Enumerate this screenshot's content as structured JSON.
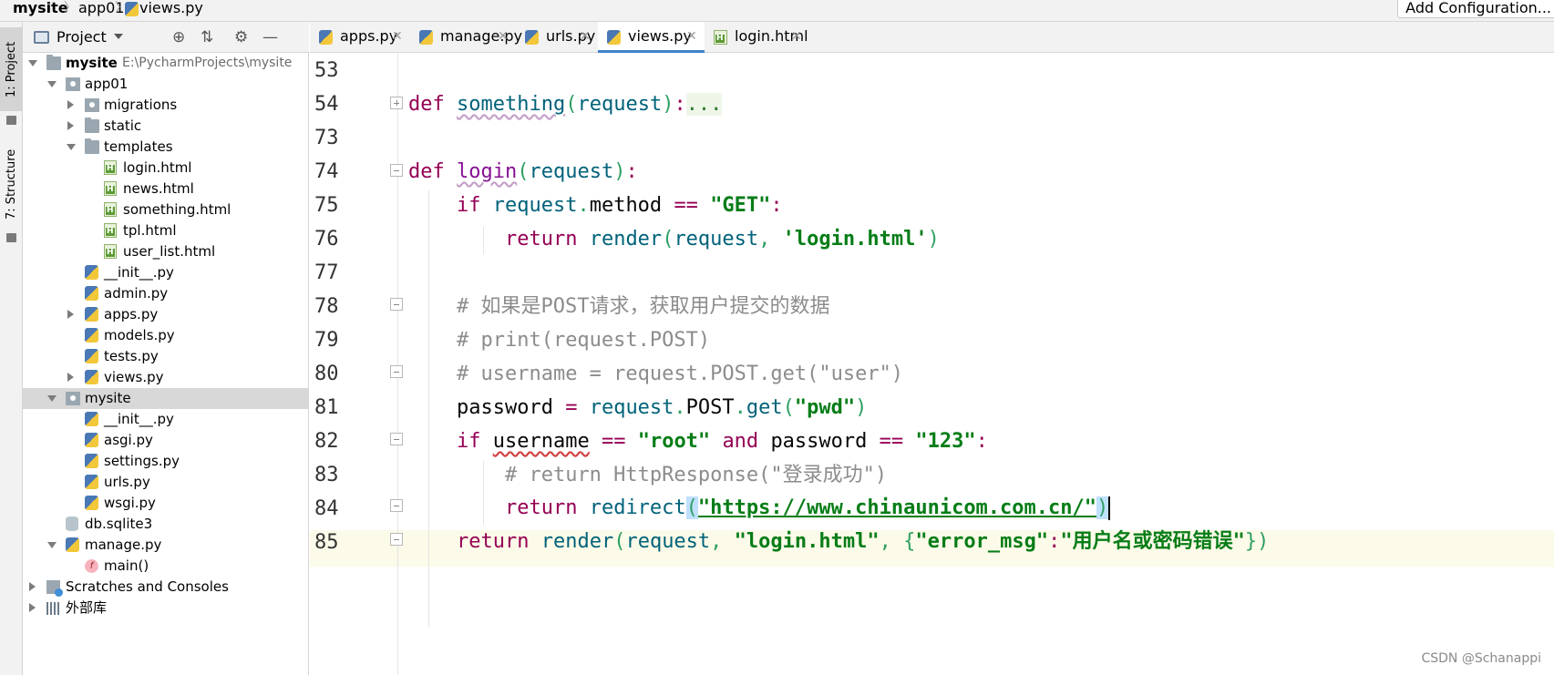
{
  "breadcrumb": [
    "mysite",
    "app01",
    "views.py"
  ],
  "toolbar": {
    "add_config": "Add Configuration..."
  },
  "stripe": {
    "project": "1: Project",
    "structure": "7: Structure"
  },
  "project_panel": {
    "title": "Project",
    "tree": [
      {
        "label": "mysite",
        "path": "E:\\PycharmProjects\\mysite",
        "icon": "folder-icon",
        "arrow": "open",
        "depth": 0,
        "bold": true
      },
      {
        "label": "app01",
        "icon": "package-icon",
        "arrow": "open",
        "depth": 1
      },
      {
        "label": "migrations",
        "icon": "package-icon",
        "arrow": "closed",
        "depth": 2
      },
      {
        "label": "static",
        "icon": "folder-icon",
        "arrow": "closed",
        "depth": 2
      },
      {
        "label": "templates",
        "icon": "folder-icon",
        "arrow": "open",
        "depth": 2
      },
      {
        "label": "login.html",
        "icon": "html-file-icon",
        "depth": 3
      },
      {
        "label": "news.html",
        "icon": "html-file-icon",
        "depth": 3
      },
      {
        "label": "something.html",
        "icon": "html-file-icon",
        "depth": 3
      },
      {
        "label": "tpl.html",
        "icon": "html-file-icon",
        "depth": 3
      },
      {
        "label": "user_list.html",
        "icon": "html-file-icon",
        "depth": 3
      },
      {
        "label": "__init__.py",
        "icon": "python-file-icon",
        "depth": 2
      },
      {
        "label": "admin.py",
        "icon": "python-file-icon",
        "depth": 2
      },
      {
        "label": "apps.py",
        "icon": "python-file-icon",
        "arrow": "closed",
        "depth": 2
      },
      {
        "label": "models.py",
        "icon": "python-file-icon",
        "depth": 2
      },
      {
        "label": "tests.py",
        "icon": "python-file-icon",
        "depth": 2
      },
      {
        "label": "views.py",
        "icon": "python-file-icon",
        "arrow": "closed",
        "depth": 2
      },
      {
        "label": "mysite",
        "icon": "package-icon",
        "arrow": "open",
        "depth": 1,
        "selected": true
      },
      {
        "label": "__init__.py",
        "icon": "python-file-icon",
        "depth": 2
      },
      {
        "label": "asgi.py",
        "icon": "python-file-icon",
        "depth": 2
      },
      {
        "label": "settings.py",
        "icon": "python-file-icon",
        "depth": 2
      },
      {
        "label": "urls.py",
        "icon": "python-file-icon",
        "depth": 2
      },
      {
        "label": "wsgi.py",
        "icon": "python-file-icon",
        "depth": 2
      },
      {
        "label": "db.sqlite3",
        "icon": "database-icon",
        "depth": 1
      },
      {
        "label": "manage.py",
        "icon": "python-file-icon",
        "arrow": "open",
        "depth": 1
      },
      {
        "label": "main()",
        "icon": "function-icon",
        "depth": 2
      },
      {
        "label": "Scratches and Consoles",
        "icon": "scratches-icon",
        "arrow": "closed",
        "depth": 0
      },
      {
        "label": "外部库",
        "icon": "library-icon",
        "arrow": "closed",
        "depth": 0
      }
    ]
  },
  "tabs": [
    {
      "label": "apps.py",
      "icon": "python-file-icon"
    },
    {
      "label": "manage.py",
      "icon": "python-file-icon"
    },
    {
      "label": "urls.py",
      "icon": "python-file-icon"
    },
    {
      "label": "views.py",
      "icon": "python-file-icon",
      "active": true
    },
    {
      "label": "login.html",
      "icon": "html-file-icon"
    }
  ],
  "editor": {
    "line_numbers": [
      "53",
      "54",
      "73",
      "74",
      "75",
      "76",
      "77",
      "78",
      "79",
      "80",
      "81",
      "82",
      "83",
      "84",
      "85"
    ],
    "code": {
      "l54_def": "def",
      "l54_name": "something",
      "l54_param": "request",
      "l54_fold": "...",
      "l74_def": "def",
      "l74_name": "login",
      "l74_param": "request",
      "l75_if": "if",
      "l75_req": "request",
      "l75_method": "method",
      "l75_str": "\"GET\"",
      "l76_return": "return",
      "l76_fn": "render",
      "l76_req": "request",
      "l76_str": "'login.html'",
      "l78_comment": "# 如果是POST请求，获取用户提交的数据",
      "l79_comment": "# print(request.POST)",
      "l80_comment": "# username = request.POST.get(\"user\")",
      "l81_var": "password",
      "l81_req": "request",
      "l81_post": "POST",
      "l81_get": "get",
      "l81_str": "\"pwd\"",
      "l82_if": "if",
      "l82_user": "username",
      "l82_str1": "\"root\"",
      "l82_and": "and",
      "l82_pwd": "password",
      "l82_str2": "\"123\"",
      "l83_comment": "# return HttpResponse(\"登录成功\")",
      "l84_return": "return",
      "l84_fn": "redirect",
      "l84_str": "\"https://www.chinaunicom.com.cn/\"",
      "l85_return": "return",
      "l85_fn": "render",
      "l85_req": "request",
      "l85_str": "\"login.html\"",
      "l85_key": "\"error_msg\"",
      "l85_val": "\"用户名或密码错误\""
    }
  },
  "watermark": "CSDN @Schanappi"
}
